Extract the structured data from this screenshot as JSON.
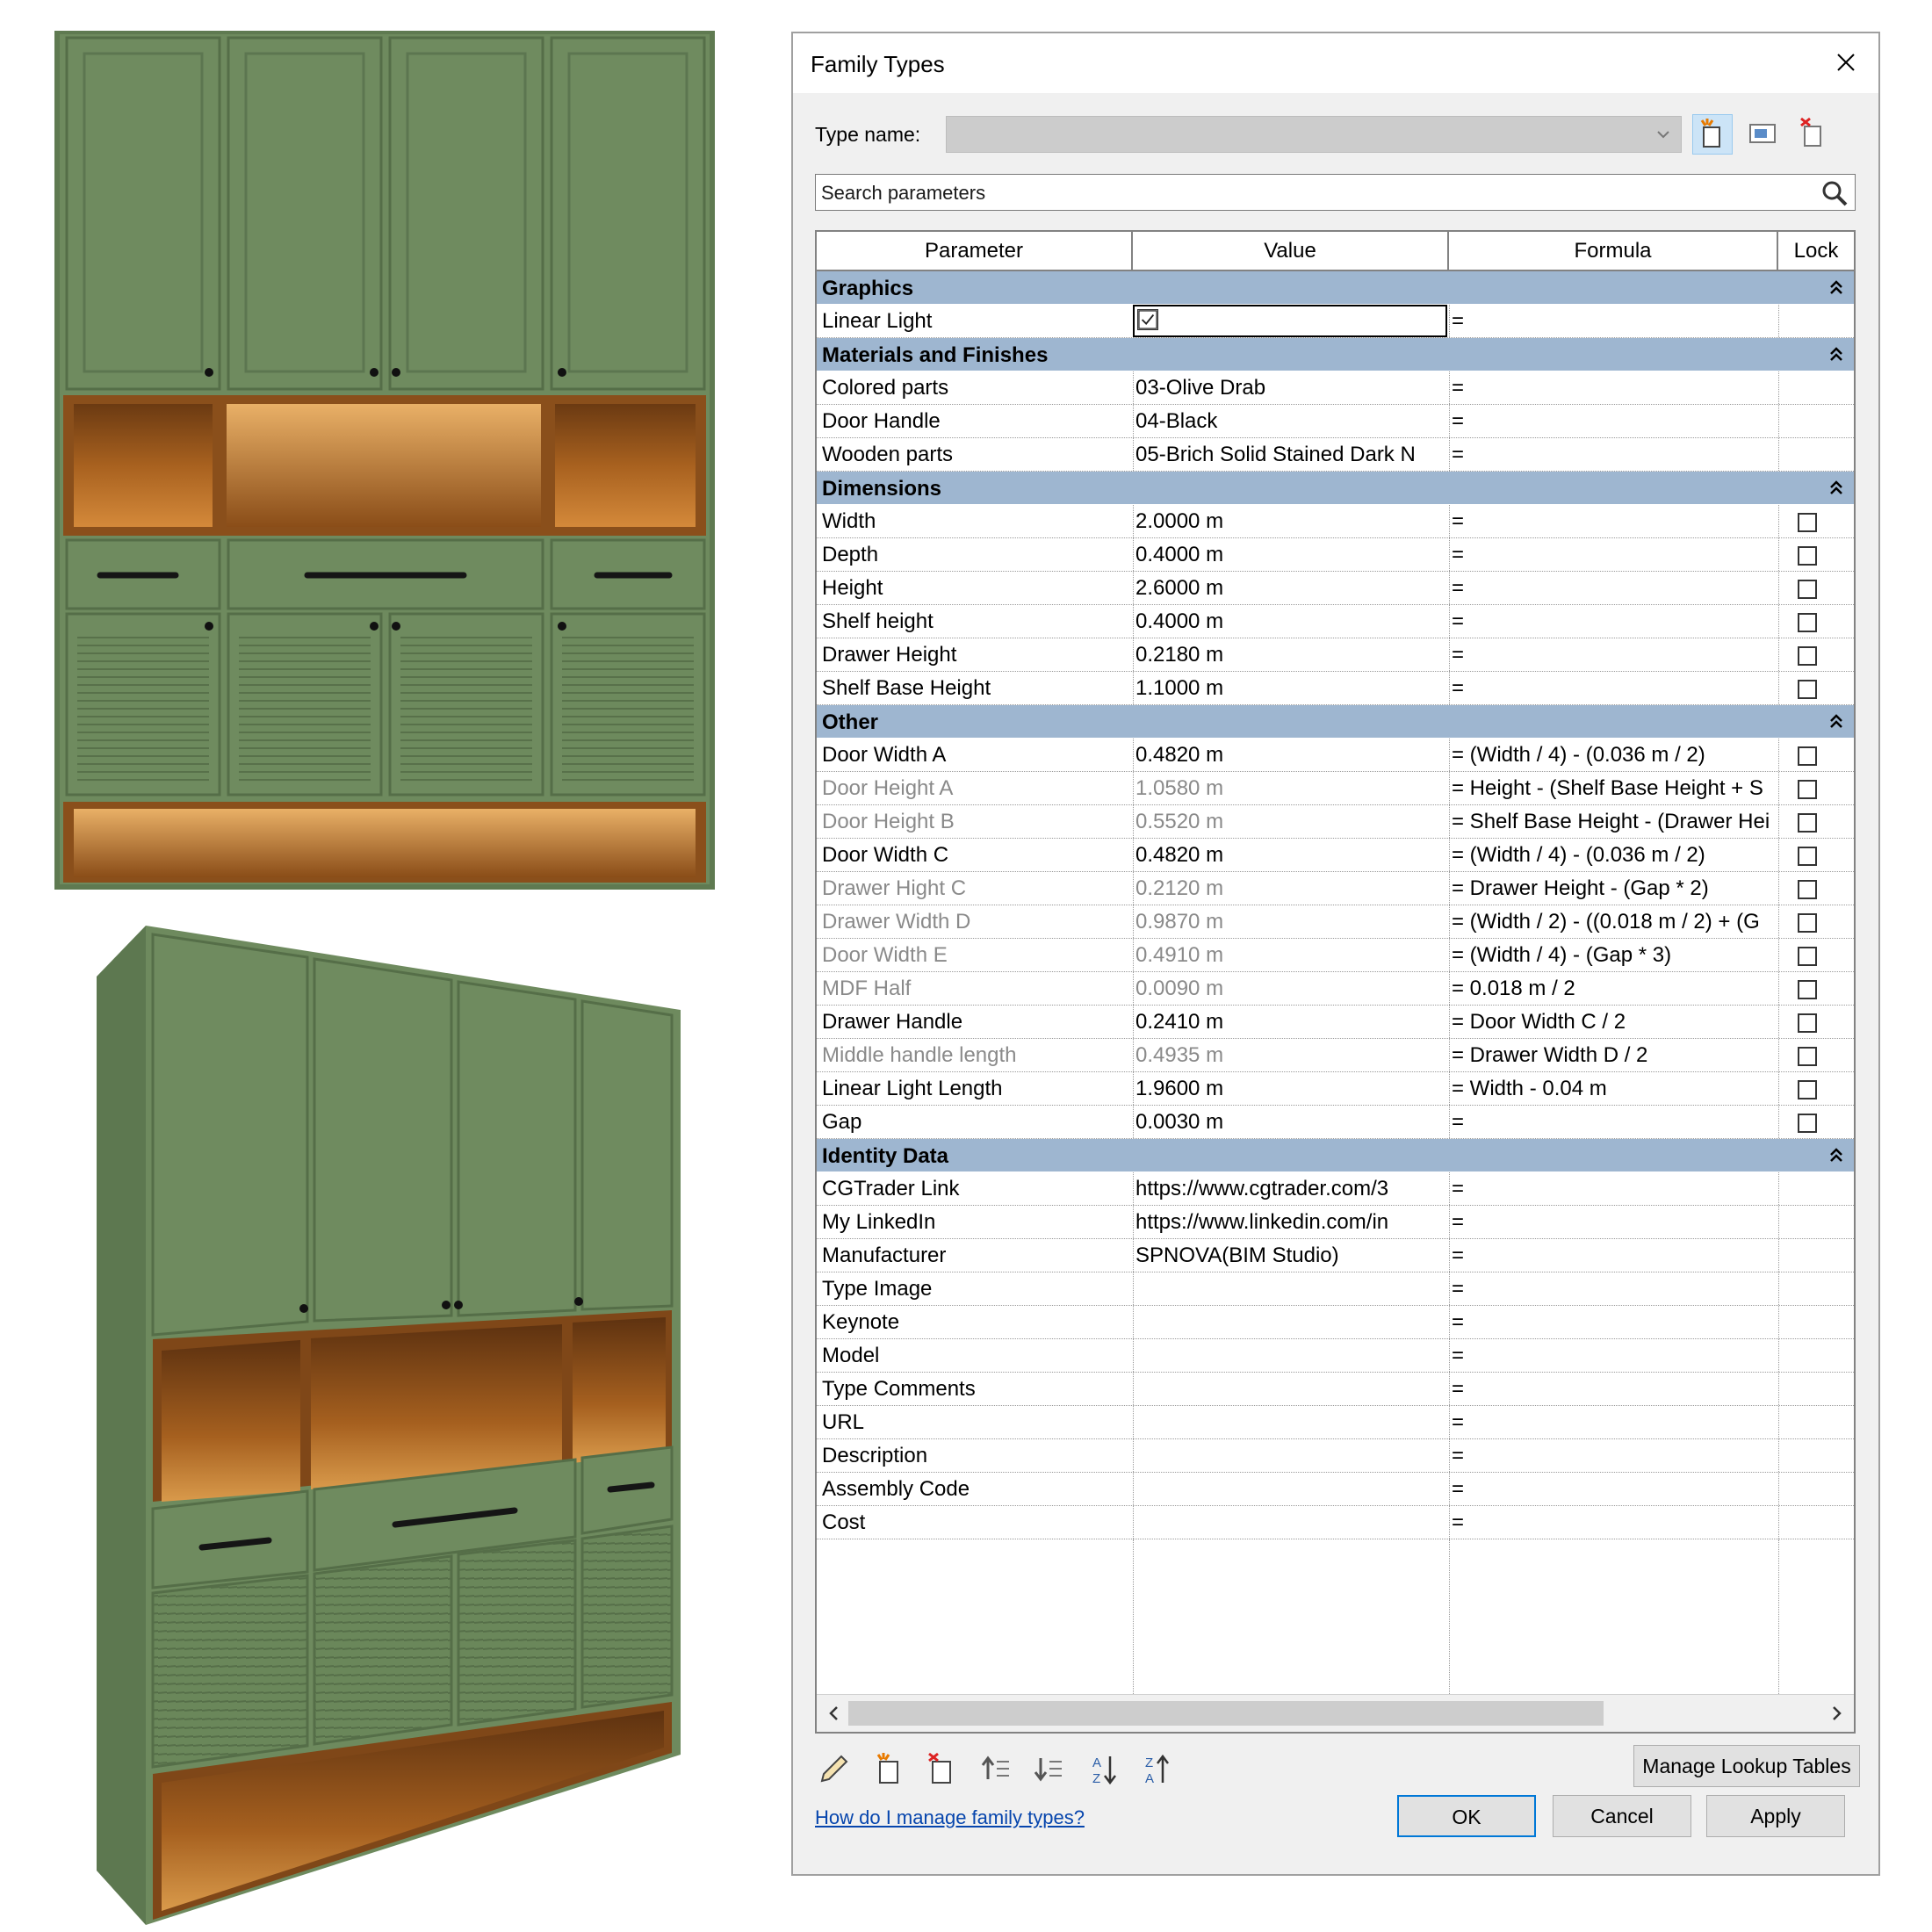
{
  "dialog": {
    "title": "Family Types",
    "type_name_label": "Type name:",
    "type_name_value": "",
    "search_placeholder": "Search parameters",
    "columns": {
      "parameter": "Parameter",
      "value": "Value",
      "formula": "Formula",
      "lock": "Lock"
    },
    "groups": [
      {
        "name": "Graphics",
        "rows": [
          {
            "param": "Linear Light",
            "value": "",
            "formula": "=",
            "checkbox_value": true,
            "checked": true,
            "lock": null,
            "dim": false
          }
        ]
      },
      {
        "name": "Materials and Finishes",
        "rows": [
          {
            "param": "Colored parts",
            "value": "03-Olive Drab",
            "formula": "=",
            "lock": null,
            "dim": false
          },
          {
            "param": "Door Handle",
            "value": "04-Black",
            "formula": "=",
            "lock": null,
            "dim": false
          },
          {
            "param": "Wooden parts",
            "value": "05-Brich Solid Stained Dark N",
            "formula": "=",
            "lock": null,
            "dim": false
          }
        ]
      },
      {
        "name": "Dimensions",
        "rows": [
          {
            "param": "Width",
            "value": "2.0000 m",
            "formula": "=",
            "lock": false,
            "dim": false
          },
          {
            "param": "Depth",
            "value": "0.4000 m",
            "formula": "=",
            "lock": false,
            "dim": false
          },
          {
            "param": "Height",
            "value": "2.6000 m",
            "formula": "=",
            "lock": false,
            "dim": false
          },
          {
            "param": "Shelf height",
            "value": "0.4000 m",
            "formula": "=",
            "lock": false,
            "dim": false
          },
          {
            "param": "Drawer Height",
            "value": "0.2180 m",
            "formula": "=",
            "lock": false,
            "dim": false
          },
          {
            "param": "Shelf Base Height",
            "value": "1.1000 m",
            "formula": "=",
            "lock": false,
            "dim": false
          }
        ]
      },
      {
        "name": "Other",
        "rows": [
          {
            "param": "Door Width A",
            "value": "0.4820 m",
            "formula": "= (Width / 4) - (0.036 m / 2)",
            "lock": false,
            "dim": false
          },
          {
            "param": "Door Height A",
            "value": "1.0580 m",
            "formula": "= Height - (Shelf Base Height + S",
            "lock": false,
            "dim": true
          },
          {
            "param": "Door Height B",
            "value": "0.5520 m",
            "formula": "= Shelf Base Height - (Drawer Hei",
            "lock": false,
            "dim": true
          },
          {
            "param": "Door Width C",
            "value": "0.4820 m",
            "formula": "= (Width / 4) - (0.036 m / 2)",
            "lock": false,
            "dim": false
          },
          {
            "param": "Drawer Hight C",
            "value": "0.2120 m",
            "formula": "= Drawer Height - (Gap * 2)",
            "lock": false,
            "dim": true
          },
          {
            "param": "Drawer Width D",
            "value": "0.9870 m",
            "formula": "= (Width / 2) - ((0.018 m / 2) + (G",
            "lock": false,
            "dim": true
          },
          {
            "param": "Door Width E",
            "value": "0.4910 m",
            "formula": "= (Width / 4) - (Gap * 3)",
            "lock": false,
            "dim": true
          },
          {
            "param": "MDF Half",
            "value": "0.0090 m",
            "formula": "= 0.018 m / 2",
            "lock": false,
            "dim": true
          },
          {
            "param": "Drawer Handle",
            "value": "0.2410 m",
            "formula": "= Door Width C / 2",
            "lock": false,
            "dim": false
          },
          {
            "param": "Middle handle length",
            "value": "0.4935 m",
            "formula": "= Drawer Width D / 2",
            "lock": false,
            "dim": true
          },
          {
            "param": "Linear Light Length",
            "value": "1.9600 m",
            "formula": "= Width - 0.04 m",
            "lock": false,
            "dim": false
          },
          {
            "param": "Gap",
            "value": "0.0030 m",
            "formula": "=",
            "lock": false,
            "dim": false
          }
        ]
      },
      {
        "name": "Identity Data",
        "rows": [
          {
            "param": "CGTrader Link",
            "value": "https://www.cgtrader.com/3",
            "formula": "=",
            "lock": null,
            "dim": false
          },
          {
            "param": "My LinkedIn",
            "value": "https://www.linkedin.com/in",
            "formula": "=",
            "lock": null,
            "dim": false
          },
          {
            "param": "Manufacturer",
            "value": "SPNOVA(BIM Studio)",
            "formula": "=",
            "lock": null,
            "dim": false
          },
          {
            "param": "Type Image",
            "value": "",
            "formula": "=",
            "lock": null,
            "dim": false
          },
          {
            "param": "Keynote",
            "value": "",
            "formula": "=",
            "lock": null,
            "dim": false
          },
          {
            "param": "Model",
            "value": "",
            "formula": "=",
            "lock": null,
            "dim": false
          },
          {
            "param": "Type Comments",
            "value": "",
            "formula": "=",
            "lock": null,
            "dim": false
          },
          {
            "param": "URL",
            "value": "",
            "formula": "=",
            "lock": null,
            "dim": false
          },
          {
            "param": "Description",
            "value": "",
            "formula": "=",
            "lock": null,
            "dim": false
          },
          {
            "param": "Assembly Code",
            "value": "",
            "formula": "=",
            "lock": null,
            "dim": false
          },
          {
            "param": "Cost",
            "value": "",
            "formula": "=",
            "lock": null,
            "dim": false
          }
        ]
      }
    ],
    "manage_lookup_label": "Manage Lookup Tables",
    "help_link": "How do I manage family types?",
    "ok_label": "OK",
    "cancel_label": "Cancel",
    "apply_label": "Apply"
  },
  "colors": {
    "group_header": "#9eb6d0",
    "cabinet_green": "#6e8a5e",
    "wood": "#b9702c",
    "link": "#0645ad"
  },
  "icons": [
    "close-icon",
    "chevron-down-icon",
    "new-type-icon",
    "rename-type-icon",
    "delete-type-icon",
    "search-icon",
    "collapse-icon",
    "edit-parameter-icon",
    "new-parameter-icon",
    "delete-parameter-icon",
    "move-up-icon",
    "move-down-icon",
    "sort-ascending-icon",
    "sort-descending-icon"
  ]
}
